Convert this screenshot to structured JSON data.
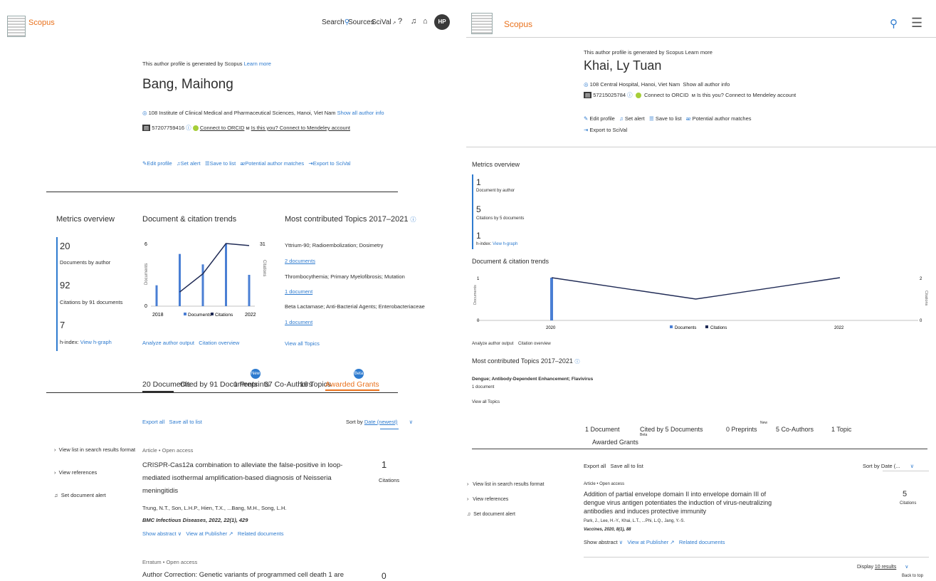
{
  "left": {
    "brand": "Scopus",
    "nav": {
      "search": "Search",
      "sources": "Sources",
      "scival": "SciVal",
      "avatar": "HP"
    },
    "profile_note": "This author profile is generated by Scopus",
    "learn_more": "Learn more",
    "author_name": "Bang, Maihong",
    "affiliation": "108 Institute of Clinical Medical and Pharmaceutical Sciences, Hanoi, Viet Nam",
    "show_all_info": "Show all author info",
    "author_id": "57207759416",
    "connect_orcid": "Connect to ORCID",
    "is_this_you": "Is this you? Connect to Mendeley account",
    "actions": [
      "Edit profile",
      "Set alert",
      "Save to list",
      "Potential author matches",
      "Export to SciVal"
    ],
    "metrics_title": "Metrics overview",
    "metrics": [
      {
        "value": "20",
        "label": "Documents by author"
      },
      {
        "value": "92",
        "label": "Citations by 91 documents"
      },
      {
        "value": "7",
        "label": "h-index:",
        "link": "View h-graph"
      }
    ],
    "trends_title": "Document & citation trends",
    "trends_axis_left": "Documents",
    "trends_axis_right": "Citations",
    "trends_ytop_left": "6",
    "trends_ytop_right": "31",
    "trends_ybot": "0",
    "trends_x": [
      "2018",
      "2022"
    ],
    "legend_docs": "Documents",
    "legend_cites": "Citations",
    "analyze": "Analyze author output",
    "citation_overview": "Citation overview",
    "topics_title": "Most contributed Topics 2017–2021",
    "topics": [
      {
        "name": "Yttrium-90; Radioembolization; Dosimetry",
        "count": "2 documents"
      },
      {
        "name": "Thrombocythemia; Primary Myelofibrosis; Mutation",
        "count": "1 document"
      },
      {
        "name": "Beta Lactamase; Anti-Bacterial Agents; Enterobacteriaceae",
        "count": "1 document"
      }
    ],
    "view_all_topics": "View all Topics",
    "tabs": [
      "20 Documents",
      "Cited by 91 Documents",
      "1 Preprints",
      "67 Co-Authors",
      "16 Topics",
      "Awarded Grants"
    ],
    "badge_new": "New",
    "badge_beta": "Beta",
    "export_all": "Export all",
    "save_all": "Save all to list",
    "sort_by": "Sort by",
    "sort_value": "Date (newest)",
    "side_links": [
      "View list in search results format",
      "View references",
      "Set document alert"
    ],
    "doc1": {
      "type": "Article • Open access",
      "title_l1": "CRISPR-Cas12a combination to alleviate the false-positive in loop-",
      "title_l2": "mediated isothermal amplification-based diagnosis of Neisseria",
      "title_l3": "meningitidis",
      "authors": "Trung, N.T., Son, L.H.P., Hien, T.X., ...Bang, M.H., Song, L.H.",
      "source": "BMC Infectious Diseases, 2022, 22(1), 429",
      "show_abstract": "Show abstract",
      "view_publisher": "View at Publisher",
      "related": "Related documents",
      "citations": "1",
      "citations_label": "Citations"
    },
    "doc2": {
      "type": "Erratum • Open access",
      "title_l1": "Author Correction: Genetic variants of programmed cell death 1 are",
      "citations": "0"
    }
  },
  "right": {
    "brand": "Scopus",
    "profile_note": "This author profile is generated by Scopus",
    "learn_more": "Learn more",
    "author_name": "Khai, Ly Tuan",
    "affiliation": "108 Central Hospital, Hanoi, Viet Nam",
    "show_all_info": "Show all author info",
    "author_id": "57215025784",
    "connect_orcid": "Connect to ORCID",
    "is_this_you": "Is this you? Connect to Mendeley account",
    "actions": [
      "Edit profile",
      "Set alert",
      "Save to list",
      "Potential author matches"
    ],
    "export_scival": "Export to SciVal",
    "metrics_title": "Metrics overview",
    "metrics": [
      {
        "value": "1",
        "label": "Document by author"
      },
      {
        "value": "5",
        "label": "Citations by 5 documents"
      },
      {
        "value": "1",
        "label": "h-index:",
        "link": "View h-graph"
      }
    ],
    "trends_title": "Document & citation trends",
    "axis_left": "Documents",
    "axis_right": "Citations",
    "ytop_left": "1",
    "ytop_right": "2",
    "ybot_left": "0",
    "ybot_right": "0",
    "x_labels": [
      "2020",
      "2022"
    ],
    "legend_docs": "Documents",
    "legend_cites": "Citations",
    "analyze": "Analyze author output",
    "citation_overview": "Citation overview",
    "topics_title": "Most contributed Topics 2017–2021",
    "topic_name": "Dengue; Antibody-Dependent Enhancement; Flavivirus",
    "topic_count": "1 document",
    "view_all_topics": "View all Topics",
    "tabs": [
      "1 Document",
      "Cited by 5 Documents",
      "0 Preprints",
      "5 Co-Authors",
      "1 Topic"
    ],
    "tab_grants": "Awarded Grants",
    "badge_new": "New",
    "badge_beta": "Beta",
    "export_all": "Export all",
    "save_all": "Save all to list",
    "sort_by": "Sort by",
    "sort_value": "Date (...",
    "side_links": [
      "View list in search results format",
      "View references",
      "Set document alert"
    ],
    "doc": {
      "type": "Article • Open access",
      "title_l1": "Addition of partial envelope domain II into envelope domain III of",
      "title_l2": "dengue virus antigen potentiates the induction of virus-neutralizing",
      "title_l3": "antibodies and induces protective immunity",
      "authors": "Park, J., Lee, H.-Y., Khai, L.T., ...Phi, L.Q., Jang, Y.-S.",
      "source": "Vaccines, 2020, 8(1), 88",
      "show_abstract": "Show abstract",
      "view_publisher": "View at Publisher",
      "related": "Related documents",
      "citations": "5",
      "citations_label": "Citations"
    },
    "display_label": "Display",
    "display_value": "10 results",
    "back_to_top": "Back to top"
  },
  "colors": {
    "accent": "#2e7bcf",
    "brand": "#e9711c",
    "orcid": "#a6ce39"
  },
  "chart_data": [
    {
      "type": "bar",
      "title": "Document & citation trends",
      "categories": [
        "2018",
        "2019",
        "2020",
        "2021",
        "2022"
      ],
      "series": [
        {
          "name": "Documents",
          "values": [
            2,
            5,
            4,
            6,
            3
          ]
        },
        {
          "name": "Citations",
          "values": [
            null,
            7,
            16,
            31,
            30
          ]
        }
      ],
      "ylabel": "Documents",
      "y2label": "Citations",
      "ylim": [
        0,
        6
      ],
      "y2lim": [
        0,
        31
      ]
    },
    {
      "type": "bar",
      "title": "Document & citation trends",
      "categories": [
        "2020",
        "2021",
        "2022"
      ],
      "series": [
        {
          "name": "Documents",
          "values": [
            1,
            0,
            0
          ]
        },
        {
          "name": "Citations",
          "values": [
            2,
            1,
            2
          ]
        }
      ],
      "ylabel": "Documents",
      "y2label": "Citations",
      "ylim": [
        0,
        1
      ],
      "y2lim": [
        0,
        2
      ]
    }
  ]
}
